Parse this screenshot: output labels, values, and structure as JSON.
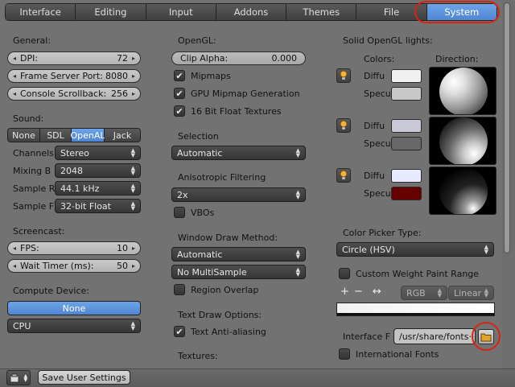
{
  "tabs": [
    "Interface",
    "Editing",
    "Input",
    "Addons",
    "Themes",
    "File",
    "System"
  ],
  "active_tab": "System",
  "general": {
    "heading": "General:",
    "dpi_label": "DPI:",
    "dpi_value": "72",
    "frame_server_label": "Frame Server Port:",
    "frame_server_value": "8080",
    "console_label": "Console Scrollback:",
    "console_value": "256"
  },
  "sound": {
    "heading": "Sound:",
    "buttons": [
      "None",
      "SDL",
      "OpenAL",
      "Jack"
    ],
    "active": "OpenAL",
    "channels_label": "Channels",
    "channels_value": "Stereo",
    "mixing_label": "Mixing B",
    "mixing_value": "2048",
    "samplerate_label": "Sample R",
    "samplerate_value": "44.1 kHz",
    "sampleformat_label": "Sample F",
    "sampleformat_value": "32-bit Float"
  },
  "screencast": {
    "heading": "Screencast:",
    "fps_label": "FPS:",
    "fps_value": "10",
    "wait_label": "Wait Timer (ms):",
    "wait_value": "50"
  },
  "compute": {
    "heading": "Compute Device:",
    "device_button": "None",
    "device_select": "CPU"
  },
  "opengl": {
    "heading": "OpenGL:",
    "clip_alpha_label": "Clip Alpha:",
    "clip_alpha_value": "0.000",
    "mipmaps": "Mipmaps",
    "gpu_mipmap": "GPU Mipmap Generation",
    "float_tex": "16 Bit Float Textures",
    "selection_heading": "Selection",
    "selection_value": "Automatic",
    "aniso_heading": "Anisotropic Filtering",
    "aniso_value": "2x",
    "vbos": "VBOs",
    "window_draw_heading": "Window Draw Method:",
    "window_draw_value": "Automatic",
    "multisample_value": "No MultiSample",
    "region_overlap": "Region Overlap",
    "text_draw_heading": "Text Draw Options:",
    "text_aa": "Text Anti-aliasing",
    "textures_heading": "Textures:"
  },
  "lights": {
    "heading": "Solid OpenGL lights:",
    "colors_label": "Colors:",
    "direction_label": "Direction:",
    "diffuse_label": "Diffu",
    "specular_label": "Specu",
    "items": [
      {
        "diffuse": "#f0f0f0",
        "specular": "#c8c8c8"
      },
      {
        "diffuse": "#c8c8d6",
        "specular": "#676767"
      },
      {
        "diffuse": "#e8eaff",
        "specular": "#660000"
      }
    ]
  },
  "color_picker": {
    "heading": "Color Picker Type:",
    "value": "Circle (HSV)",
    "custom_weight": "Custom Weight Paint Range",
    "rgb": "RGB",
    "linear": "Linear"
  },
  "interface_font": {
    "label": "Interface F",
    "path": "/usr/share/fonts··",
    "intl_fonts": "International Fonts"
  },
  "footer": {
    "save_button": "Save User Settings"
  },
  "colors": {
    "accent": "#5b92de",
    "highlight_ring": "#d8230f"
  }
}
